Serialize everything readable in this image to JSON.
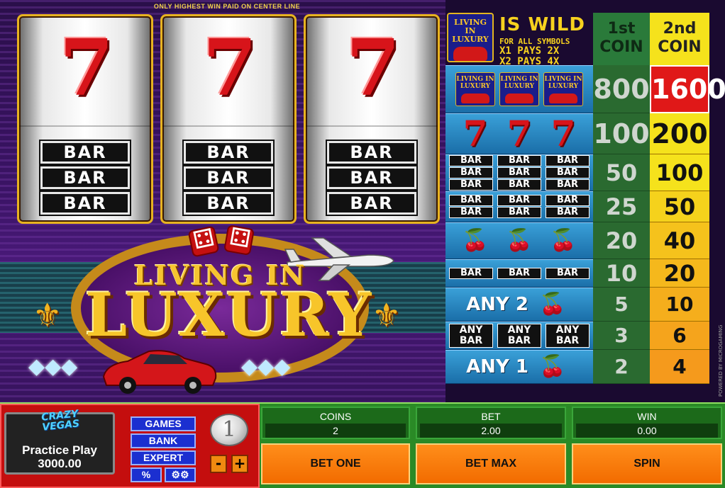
{
  "header": {
    "notice": "ONLY HIGHEST WIN PAID ON CENTER LINE"
  },
  "reels": [
    {
      "top_symbol": "7",
      "bottom_symbol": [
        "BAR",
        "BAR",
        "BAR"
      ]
    },
    {
      "top_symbol": "7",
      "bottom_symbol": [
        "BAR",
        "BAR",
        "BAR"
      ]
    },
    {
      "top_symbol": "7",
      "bottom_symbol": [
        "BAR",
        "BAR",
        "BAR"
      ]
    }
  ],
  "logo": {
    "line1": "LIVING IN",
    "line2": "LUXURY"
  },
  "wild": {
    "icon_text": [
      "LIVING IN",
      "LUXURY"
    ],
    "title": "IS WILD",
    "line1": "FOR ALL SYMBOLS",
    "line2": "X1 PAYS 2X",
    "line3": "X2 PAYS 4X"
  },
  "paytable": {
    "headers": [
      "1st COIN",
      "2nd COIN"
    ],
    "header_lines": [
      [
        "1st",
        "COIN"
      ],
      [
        "2nd",
        "COIN"
      ]
    ],
    "any2_label": "ANY 2",
    "any1_label": "ANY 1",
    "anybar_label": [
      "ANY",
      "BAR"
    ],
    "bar_label": "BAR",
    "seven_label": "7",
    "rows": [
      {
        "symbol": "luxury",
        "coin1": "800",
        "coin2": "1600"
      },
      {
        "symbol": "seven",
        "coin1": "100",
        "coin2": "200"
      },
      {
        "symbol": "triple-bar",
        "coin1": "50",
        "coin2": "100"
      },
      {
        "symbol": "double-bar",
        "coin1": "25",
        "coin2": "50"
      },
      {
        "symbol": "cherry",
        "coin1": "20",
        "coin2": "40"
      },
      {
        "symbol": "single-bar",
        "coin1": "10",
        "coin2": "20"
      },
      {
        "symbol": "any2-cherry",
        "coin1": "5",
        "coin2": "10"
      },
      {
        "symbol": "any-bar",
        "coin1": "3",
        "coin2": "6"
      },
      {
        "symbol": "any1-cherry",
        "coin1": "2",
        "coin2": "4"
      }
    ]
  },
  "powered_by": "POWERED BY MICROGAMING",
  "casino": {
    "logo": [
      "CRAZY",
      "VEGAS"
    ],
    "mode": "Practice Play",
    "credit": "3000.00"
  },
  "menu": {
    "games": "GAMES",
    "bank": "BANK",
    "expert": "EXPERT",
    "percent": "%",
    "settings_icon": "gears-icon"
  },
  "coin_size": {
    "value": "1",
    "minus": "-",
    "plus": "+"
  },
  "stats": {
    "coins": {
      "label": "COINS",
      "value": "2"
    },
    "bet": {
      "label": "BET",
      "value": "2.00"
    },
    "win": {
      "label": "WIN",
      "value": "0.00"
    }
  },
  "actions": {
    "bet_one": "BET ONE",
    "bet_max": "BET MAX",
    "spin": "SPIN"
  },
  "colors": {
    "accent_gold": "#f7c52a",
    "reel_frame": "#e7b320",
    "action_orange": "#f26b00",
    "coin2_highlight": "#e01818"
  }
}
